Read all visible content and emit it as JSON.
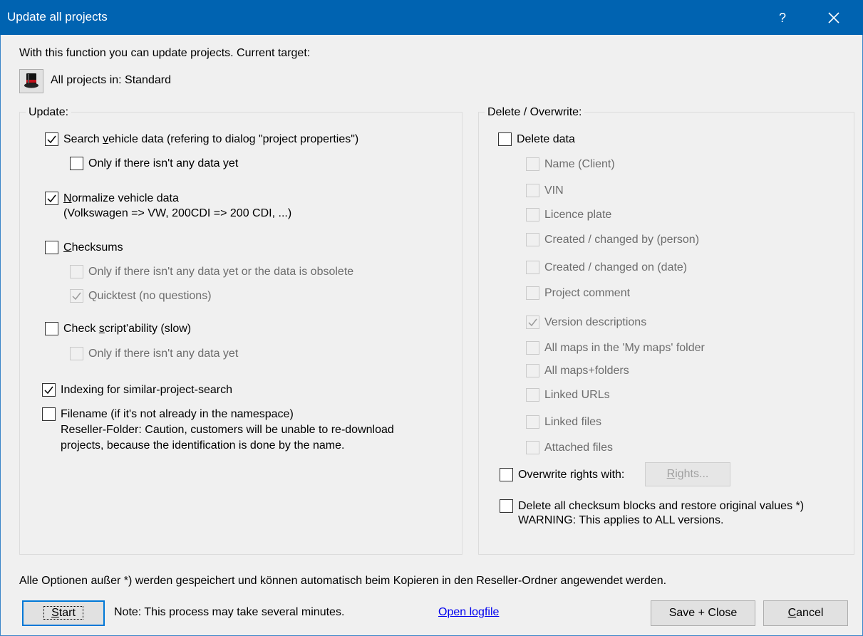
{
  "window": {
    "title": "Update all projects",
    "help_label": "?"
  },
  "intro": "With this function you can update projects. Current target:",
  "target": {
    "icon": "top-hat-icon",
    "label": "All projects in: Standard"
  },
  "update_group": {
    "label": "Update:",
    "search_vehicle": {
      "label": "Search vehicle data (refering to dialog \"project properties\")",
      "checked": true
    },
    "search_only_if_none": {
      "label": "Only if there isn't any data yet",
      "checked": false
    },
    "normalize": {
      "label": "Normalize vehicle data",
      "sub": "(Volkswagen => VW, 200CDI => 200 CDI, ...)",
      "checked": true
    },
    "checksums": {
      "label": "Checksums",
      "checked": false
    },
    "checksums_only_if": {
      "label": "Only if there isn't any data yet or the data is obsolete",
      "checked": false
    },
    "quicktest": {
      "label": "Quicktest (no questions)",
      "checked": true
    },
    "scriptability": {
      "label": "Check script'ability (slow)",
      "checked": false
    },
    "script_only_if_none": {
      "label": "Only if there isn't any data yet",
      "checked": false
    },
    "indexing": {
      "label": "Indexing for similar-project-search",
      "checked": true
    },
    "filename": {
      "label": "Filename (if it's not already in the namespace)",
      "sub1": "Reseller-Folder: Caution, customers will be unable to re-download",
      "sub2": "projects, because the identification is done by the name.",
      "checked": false
    }
  },
  "delete_group": {
    "label": "Delete / Overwrite:",
    "delete_data": {
      "label": "Delete data",
      "checked": false
    },
    "items": [
      {
        "label": "Name (Client)",
        "checked": false
      },
      {
        "label": "VIN",
        "checked": false
      },
      {
        "label": "Licence plate",
        "checked": false
      },
      {
        "label": "Created / changed by (person)",
        "checked": false
      },
      {
        "label": "Created / changed on (date)",
        "checked": false
      },
      {
        "label": "Project comment",
        "checked": false
      },
      {
        "label": "Version descriptions",
        "checked": true
      },
      {
        "label": "All maps in the 'My maps' folder",
        "checked": false
      },
      {
        "label": "All maps+folders",
        "checked": false
      },
      {
        "label": "Linked URLs",
        "checked": false
      },
      {
        "label": "Linked files",
        "checked": false
      },
      {
        "label": "Attached files",
        "checked": false
      }
    ],
    "overwrite_rights": {
      "label": "Overwrite rights with:",
      "checked": false,
      "button": "Rights..."
    },
    "delete_checksum": {
      "label": "Delete all checksum blocks and restore original values *)",
      "sub": "WARNING: This applies to ALL versions.",
      "checked": false
    }
  },
  "footer_note": "Alle Optionen außer *) werden gespeichert und können automatisch beim Kopieren in den Reseller-Ordner angewendet werden.",
  "buttons": {
    "start": "Start",
    "note": "Note: This process may take several minutes.",
    "open_logfile": "Open logfile",
    "save_close": "Save + Close",
    "cancel": "Cancel"
  }
}
